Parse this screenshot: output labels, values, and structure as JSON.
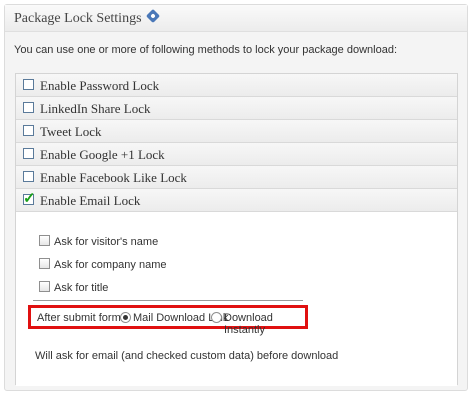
{
  "panel": {
    "title": "Package Lock Settings",
    "intro": "You can use one or more of following methods to lock your package download:"
  },
  "methods": [
    {
      "label": "Enable Password Lock",
      "checked": false
    },
    {
      "label": "LinkedIn Share Lock",
      "checked": false
    },
    {
      "label": "Tweet Lock",
      "checked": false
    },
    {
      "label": "Enable Google +1 Lock",
      "checked": false
    },
    {
      "label": "Enable Facebook Like Lock",
      "checked": false
    },
    {
      "label": "Enable Email Lock",
      "checked": true
    }
  ],
  "email": {
    "options": [
      {
        "label": "Ask for visitor's name"
      },
      {
        "label": "Ask for company name"
      },
      {
        "label": "Ask for title"
      }
    ],
    "after_submit_label": "After submit form:",
    "radio_mail": "Mail Download Link",
    "radio_instant": "Download Instantly",
    "selected": "Mail Download Link",
    "note": "Will ask for email (and checked custom data) before download"
  },
  "colors": {
    "highlight_border": "#e01010",
    "check_green": "#1aa01a"
  }
}
